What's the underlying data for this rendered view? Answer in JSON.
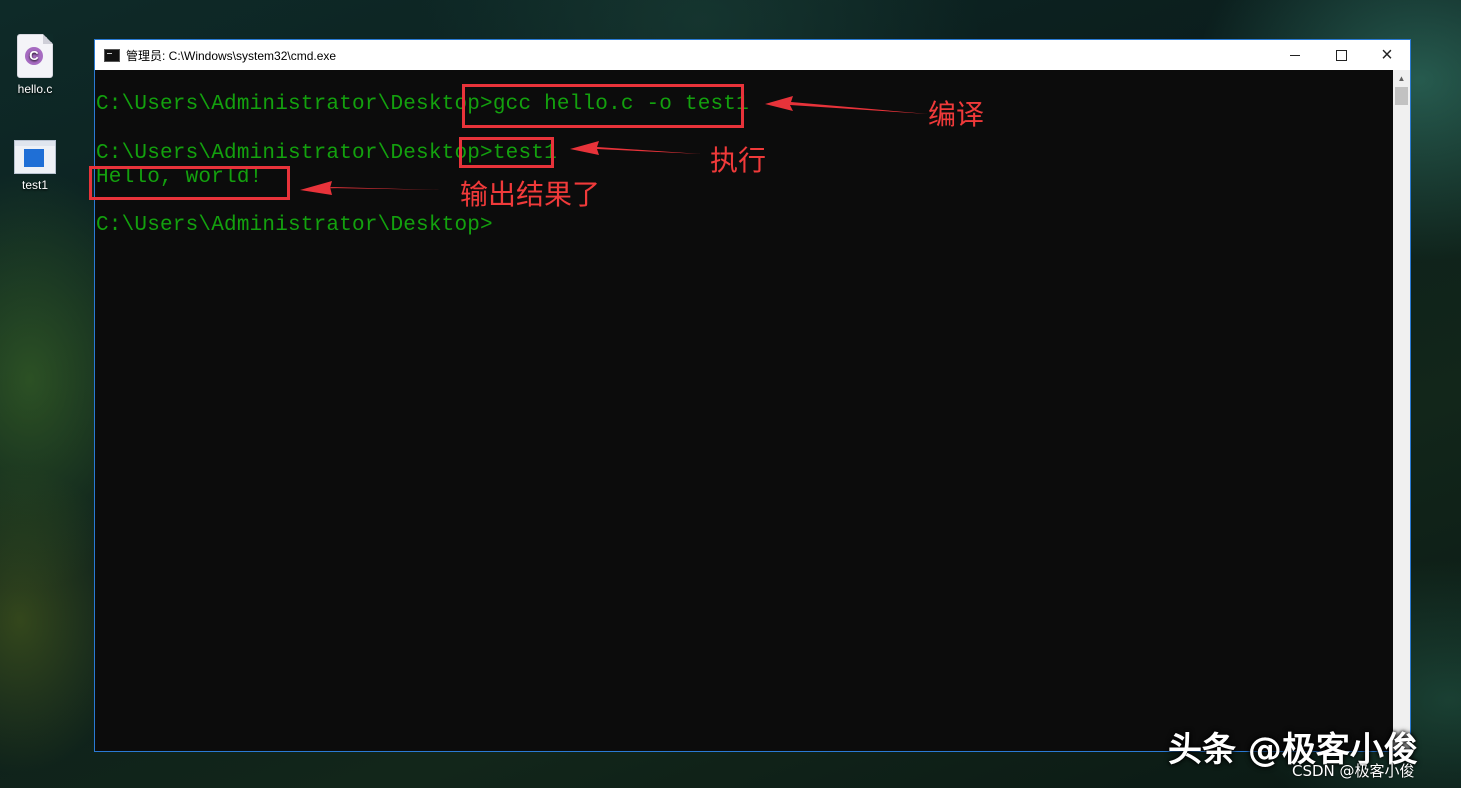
{
  "desktop": {
    "icons": [
      {
        "label": "hello.c",
        "glyph": "C",
        "icon": "c-source-file-icon"
      },
      {
        "label": "test1",
        "icon": "executable-file-icon"
      }
    ]
  },
  "window": {
    "title": "管理员: C:\\Windows\\system32\\cmd.exe",
    "controls": {
      "minimize": "minimize-icon",
      "maximize": "maximize-icon",
      "close": "×"
    }
  },
  "console": {
    "lines": [
      "C:\\Users\\Administrator\\Desktop>gcc hello.c -o test1",
      "C:\\Users\\Administrator\\Desktop>test1",
      "Hello, world!",
      "C:\\Users\\Administrator\\Desktop>"
    ],
    "colors": {
      "text": "#13a10e",
      "background": "#0c0c0c"
    }
  },
  "annotations": {
    "compile": "编译",
    "execute": "执行",
    "output": "输出结果了",
    "color": "#e8333a"
  },
  "watermark": {
    "main": "头条 @极客小俊",
    "sub": "CSDN @极客小俊"
  }
}
